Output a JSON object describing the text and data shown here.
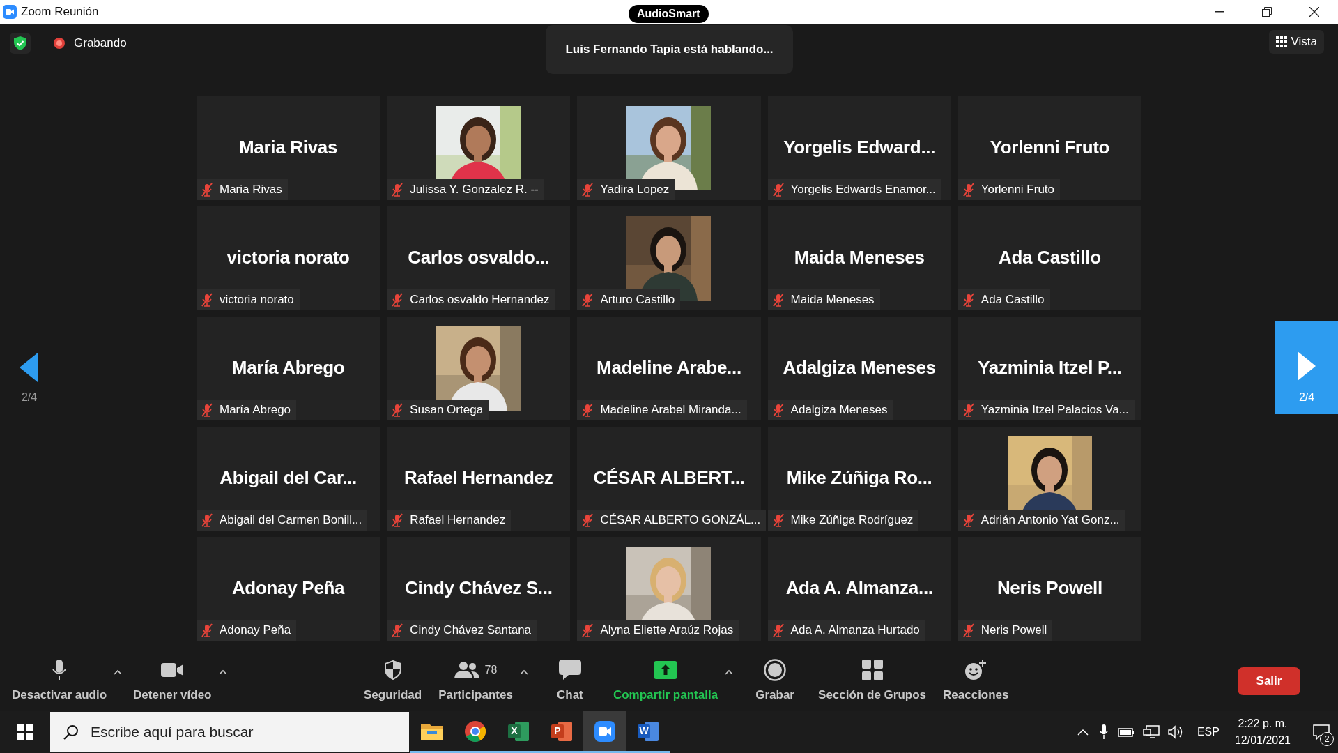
{
  "window": {
    "title": "Zoom Reunión",
    "badge": "AudioSmart"
  },
  "top_bar": {
    "secure": true,
    "recording": {
      "label": "Grabando",
      "on": true
    },
    "speaker_toast": "Luis Fernando Tapia está hablando...",
    "view_button": "Vista"
  },
  "pager": {
    "previous": "2/4",
    "next": "2/4"
  },
  "tiles": [
    {
      "kind": "name",
      "display": "Maria Rivas",
      "label": "Maria Rivas",
      "muted": true
    },
    {
      "kind": "picture",
      "label": "Julissa Y. Gonzalez R. --",
      "muted": true
    },
    {
      "kind": "picture",
      "label": "Yadira Lopez",
      "muted": true
    },
    {
      "kind": "name",
      "display": "Yorgelis Edward...",
      "label": "Yorgelis Edwards Enamor...",
      "muted": true
    },
    {
      "kind": "name",
      "display": "Yorlenni Fruto",
      "label": "Yorlenni Fruto",
      "muted": true
    },
    {
      "kind": "name",
      "display": "victoria norato",
      "label": "victoria norato",
      "muted": true
    },
    {
      "kind": "name",
      "display": "Carlos osvaldo...",
      "label": "Carlos osvaldo Hernandez",
      "muted": true
    },
    {
      "kind": "picture",
      "label": "Arturo Castillo",
      "muted": true
    },
    {
      "kind": "name",
      "display": "Maida Meneses",
      "label": "Maida Meneses",
      "muted": true
    },
    {
      "kind": "name",
      "display": "Ada Castillo",
      "label": "Ada Castillo",
      "muted": true
    },
    {
      "kind": "name",
      "display": "María Abrego",
      "label": "María Abrego",
      "muted": true
    },
    {
      "kind": "picture",
      "label": "Susan Ortega",
      "muted": true
    },
    {
      "kind": "name",
      "display": "Madeline Arabe...",
      "label": "Madeline Arabel Miranda...",
      "muted": true
    },
    {
      "kind": "name",
      "display": "Adalgiza Meneses",
      "label": "Adalgiza Meneses",
      "muted": true
    },
    {
      "kind": "name",
      "display": "Yazminia Itzel P...",
      "label": "Yazminia Itzel Palacios Va...",
      "muted": true
    },
    {
      "kind": "name",
      "display": "Abigail del Car...",
      "label": "Abigail del Carmen Bonill...",
      "muted": true
    },
    {
      "kind": "name",
      "display": "Rafael Hernandez",
      "label": "Rafael Hernandez",
      "muted": true
    },
    {
      "kind": "name",
      "display": "CÉSAR ALBERT...",
      "label": "CÉSAR ALBERTO GONZÁL...",
      "muted": true
    },
    {
      "kind": "name",
      "display": "Mike Zúñiga Ro...",
      "label": "Mike Zúñiga Rodríguez",
      "muted": true
    },
    {
      "kind": "picture",
      "label": "Adrián Antonio Yat Gonz...",
      "muted": true
    },
    {
      "kind": "name",
      "display": "Adonay Peña",
      "label": "Adonay Peña",
      "muted": true
    },
    {
      "kind": "name",
      "display": "Cindy Chávez S...",
      "label": "Cindy Chávez Santana",
      "muted": true
    },
    {
      "kind": "picture",
      "label": "Alyna Eliette Araúz Rojas",
      "muted": true
    },
    {
      "kind": "name",
      "display": "Ada A. Almanza...",
      "label": "Ada A. Almanza Hurtado",
      "muted": true
    },
    {
      "kind": "name",
      "display": "Neris Powell",
      "label": "Neris Powell",
      "muted": true
    }
  ],
  "toolbar": [
    {
      "kind": "mic",
      "label": "Desactivar audio",
      "options": true
    },
    {
      "kind": "camera",
      "label": "Detener vídeo",
      "options": true
    },
    {
      "kind": "shield",
      "label": "Seguridad",
      "options": false
    },
    {
      "kind": "people",
      "label": "Participantes",
      "count": "78",
      "options": true
    },
    {
      "kind": "chat",
      "label": "Chat",
      "options": false
    },
    {
      "kind": "share",
      "label": "Compartir pantalla",
      "options": true
    },
    {
      "kind": "record",
      "label": "Grabar",
      "options": false
    },
    {
      "kind": "rooms",
      "label": "Sección de Grupos",
      "options": false
    },
    {
      "kind": "reactions",
      "label": "Reacciones",
      "options": false
    }
  ],
  "leave_button": "Salir",
  "taskbar": {
    "search_placeholder": "Escribe aquí para buscar",
    "apps": [
      {
        "kind": "explorer",
        "selected": false
      },
      {
        "kind": "chrome",
        "selected": false
      },
      {
        "kind": "excel",
        "letter": "X",
        "selected": false
      },
      {
        "kind": "powerpoint",
        "letter": "P",
        "selected": false
      },
      {
        "kind": "zoom",
        "selected": true
      },
      {
        "kind": "word",
        "letter": "W",
        "selected": false
      }
    ],
    "language": "ESP",
    "time": "2:22 p. m.",
    "date": "12/01/2021",
    "notifications": "2"
  }
}
